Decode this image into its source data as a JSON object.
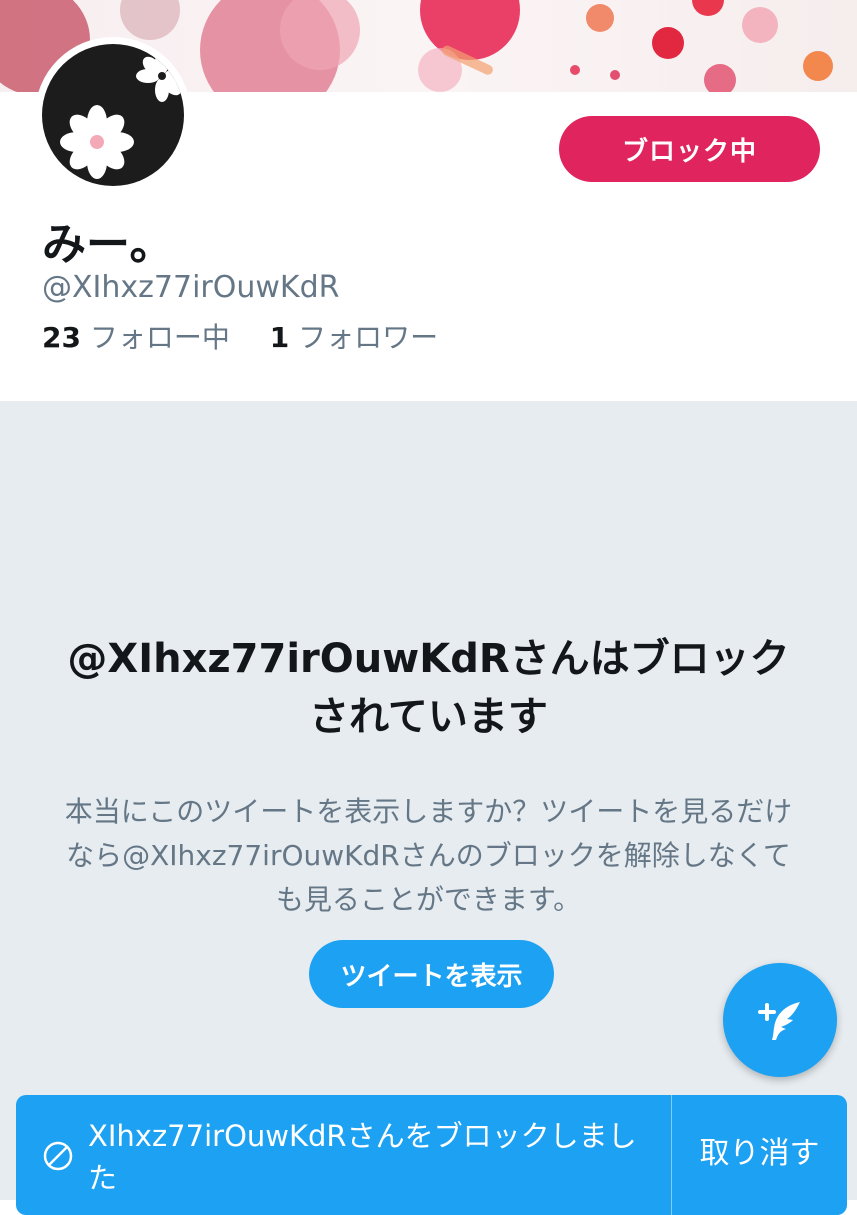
{
  "profile": {
    "block_button_label": "ブロック中",
    "display_name": "みー。",
    "handle": "@XIhxz77irOuwKdR",
    "following_count": "23",
    "following_label": "フォロー中",
    "followers_count": "1",
    "followers_label": "フォロワー"
  },
  "blocked_notice": {
    "title": "@XIhxz77irOuwKdRさんはブロックされています",
    "description": "本当にこのツイートを表示しますか？ツイートを見るだけなら@XIhxz77irOuwKdRさんのブロックを解除しなくても見ることができます。",
    "show_tweets_label": "ツイートを表示"
  },
  "toast": {
    "message": "XIhxz77irOuwKdRさんをブロックしました",
    "undo_label": "取り消す"
  },
  "icons": {
    "compose": "compose-tweet-icon",
    "blocked": "blocked-icon",
    "avatar": "daisy-flower-avatar"
  },
  "colors": {
    "block_red": "#e0245e",
    "twitter_blue": "#1da1f2",
    "background_gray": "#e6ecf0",
    "secondary_text": "#657786",
    "primary_text": "#14171a"
  }
}
